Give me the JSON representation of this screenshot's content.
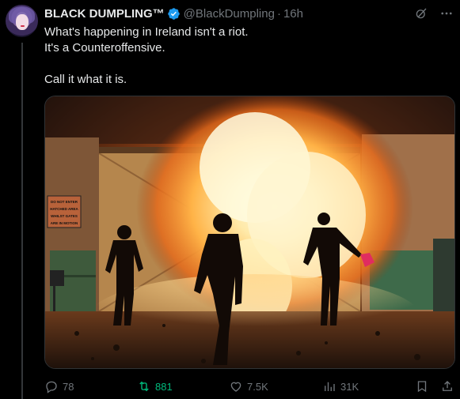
{
  "author": {
    "display_name": "BLACK DUMPLING™",
    "handle": "@BlackDumpling",
    "separator": "·",
    "time": "16h",
    "avatar_icon": "avatar-anime-girl",
    "verified_icon": "verified-badge-icon",
    "verified_color": "#1d9bf0"
  },
  "tweet": {
    "lines": [
      "What's happening in Ireland isn't a riot.",
      "It's a Counteroffensive.",
      "",
      "Call it what it is."
    ]
  },
  "media": {
    "sign_text": [
      "DO NOT ENTER",
      "HATCHED AREA",
      "WHILST GATES",
      "ARE IN MOTION"
    ]
  },
  "actions": {
    "reply_count": "78",
    "retweet_count": "881",
    "like_count": "7.5K",
    "views_count": "31K",
    "retweet_color": "#00ba7c"
  },
  "top_icons": [
    "grok-icon",
    "more-icon"
  ]
}
